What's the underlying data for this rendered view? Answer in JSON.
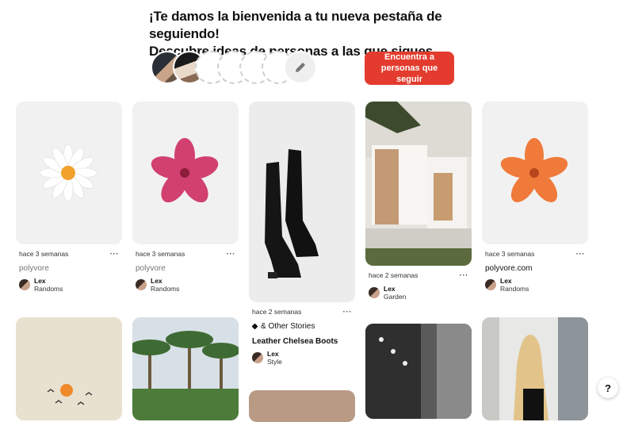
{
  "welcome": {
    "line1": "¡Te damos la bienvenida a tu nueva pestaña de seguiendo!",
    "line2": "Descubre ideas de personas a las que sigues..."
  },
  "find_button": {
    "label": "Encuentra a personas que seguir"
  },
  "help": {
    "label": "?"
  },
  "pins": [
    {
      "time": "hace 3 semanas",
      "more": "···",
      "source": "polyvore",
      "user": "Lex",
      "board": "Randoms"
    },
    {
      "time": "hace 3 semanas",
      "more": "···",
      "source": "polyvore",
      "user": "Lex",
      "board": "Randoms"
    },
    {
      "time": "hace 2 semanas",
      "more": "···",
      "source": "& Other Stories",
      "title": "Leather Chelsea Boots",
      "user": "Lex",
      "board": "Style"
    },
    {
      "time": "hace 2 semanas",
      "more": "···",
      "user": "Lex",
      "board": "Garden"
    },
    {
      "time": "hace 3 semanas",
      "more": "···",
      "source": "polyvore.com",
      "user": "Lex",
      "board": "Randoms"
    }
  ],
  "colors": {
    "accent": "#e33c2e"
  }
}
